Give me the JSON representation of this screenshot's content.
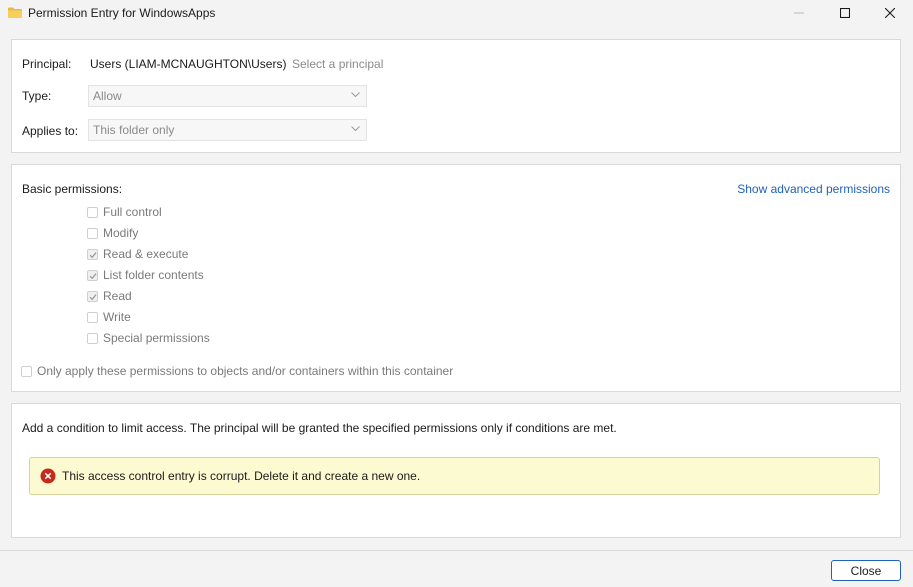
{
  "window": {
    "title": "Permission Entry for WindowsApps",
    "icon": "folder-icon",
    "controls": [
      "minimize-icon",
      "maximize-icon",
      "close-icon"
    ]
  },
  "principal_section": {
    "principal_label": "Principal:",
    "principal_value": "Users (LIAM-MCNAUGHTON\\Users)",
    "select_principal_link": "Select a principal",
    "type_label": "Type:",
    "type_value": "Allow",
    "applies_to_label": "Applies to:",
    "applies_to_value": "This folder only"
  },
  "permissions_section": {
    "heading": "Basic permissions:",
    "advanced_link": "Show advanced permissions",
    "items": [
      {
        "label": "Full control",
        "checked": false
      },
      {
        "label": "Modify",
        "checked": false
      },
      {
        "label": "Read & execute",
        "checked": true
      },
      {
        "label": "List folder contents",
        "checked": true
      },
      {
        "label": "Read",
        "checked": true
      },
      {
        "label": "Write",
        "checked": false
      },
      {
        "label": "Special permissions",
        "checked": false
      }
    ],
    "only_apply_label": "Only apply these permissions to objects and/or containers within this container",
    "only_apply_checked": false
  },
  "condition_section": {
    "description": "Add a condition to limit access. The principal will be granted the specified permissions only if conditions are met.",
    "warning_text": "This access control entry is corrupt. Delete it and create a new one.",
    "warning_icon": "error-icon"
  },
  "footer": {
    "close_label": "Close"
  },
  "colors": {
    "link_blue": "#1f62b8",
    "error_red": "#c42b1c",
    "warning_bg": "#fbfad0"
  }
}
